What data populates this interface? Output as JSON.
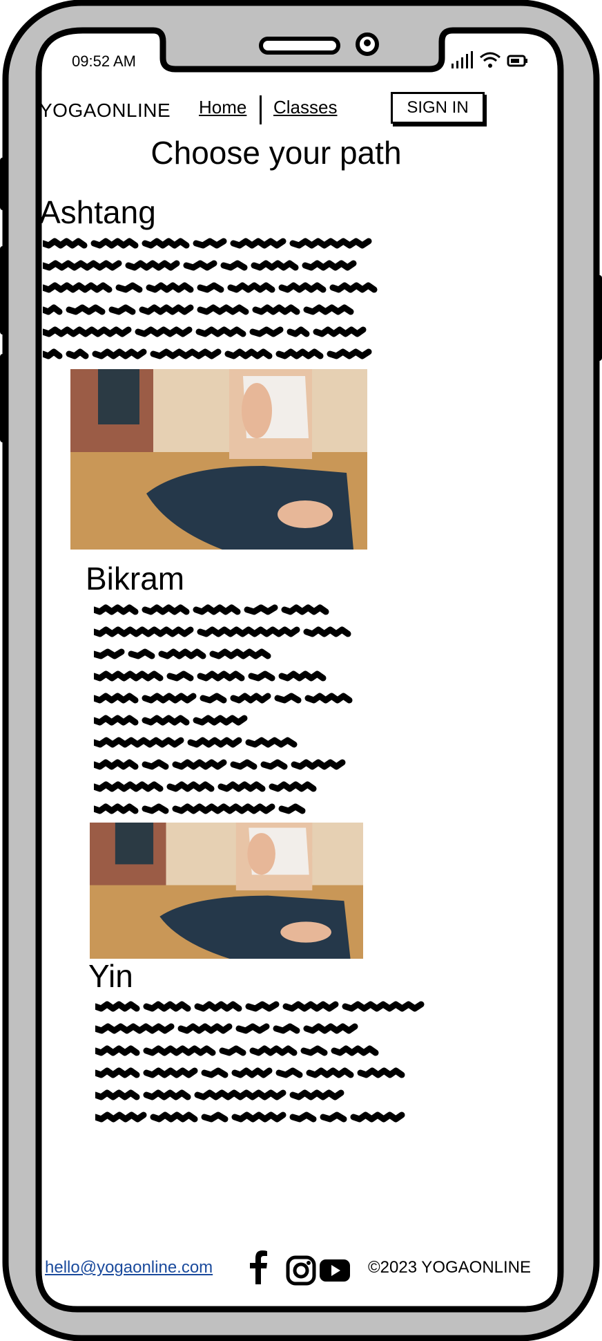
{
  "status_bar": {
    "time": "09:52 AM",
    "icons": [
      "signal-icon",
      "wifi-icon",
      "battery-icon"
    ]
  },
  "header": {
    "brand": "YOGAONLINE",
    "nav": [
      {
        "label": "Home"
      },
      {
        "label": "Classes"
      }
    ],
    "sign_in": "SIGN IN"
  },
  "main": {
    "title": "Choose your path",
    "sections": [
      {
        "heading": "Ashtang",
        "image": "yoga-meditation-photo"
      },
      {
        "heading": "Bikram",
        "image": "yoga-meditation-photo"
      },
      {
        "heading": "Yin"
      }
    ]
  },
  "footer": {
    "email": "hello@yogaonline.com",
    "social_icons": [
      "facebook-icon",
      "instagram-icon",
      "youtube-icon"
    ],
    "copyright": "©2023 YOGAONLINE"
  },
  "colors": {
    "frame": "#c0c0c0",
    "link": "#1a4a9c"
  }
}
